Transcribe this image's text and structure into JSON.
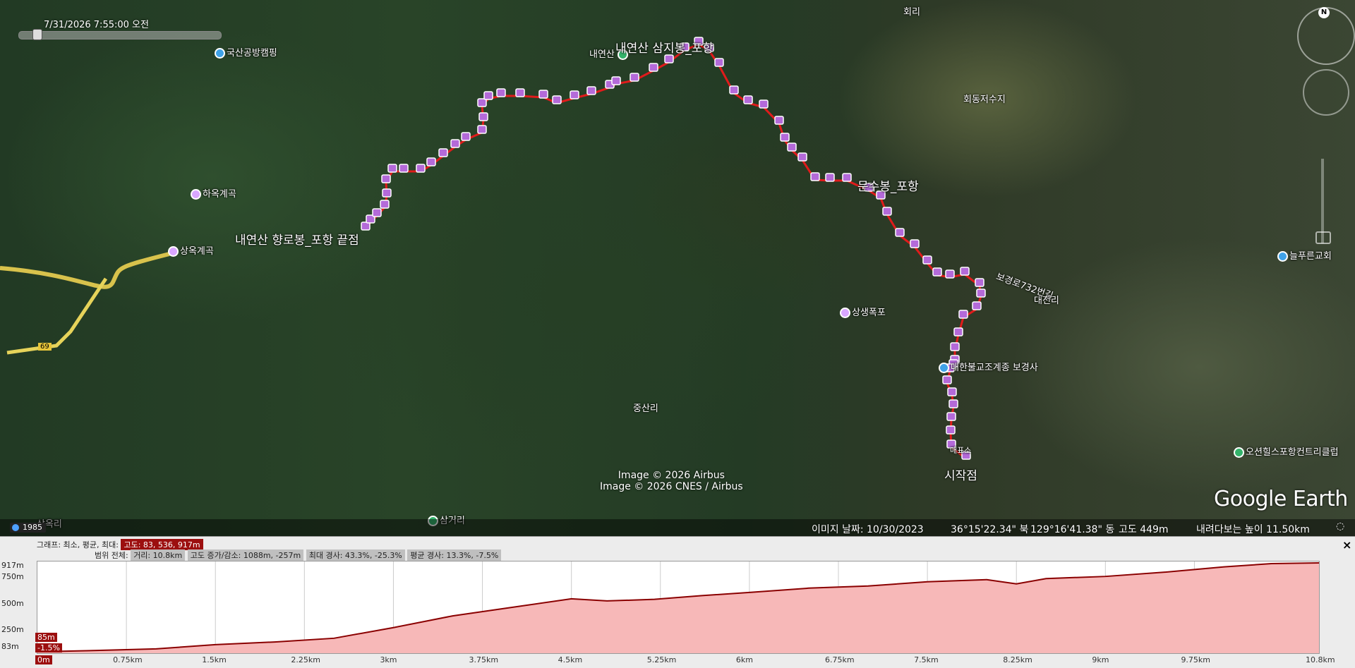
{
  "tour": {
    "timestamp": "7/31/2026   7:55:00 오전"
  },
  "map_labels": {
    "hoeri": "회리",
    "naeyeonsan": "내연산",
    "samjibong": "내연산 삼지봉_포항",
    "gugsan": "국산공방캠핑",
    "haogyegok": "하옥계곡",
    "sangok": "상옥계곡",
    "hyangrobong": "내연산 향로봉_포항 끝점",
    "munsubong": "문수봉_포항",
    "hoedong": "회동저수지",
    "daejeonri": "대전리",
    "bogyeongro": "보경로732번길",
    "sangsaeng": "상생폭포",
    "bogyeongsa": "대한불교조계종 보경사",
    "jungsanri": "중산리",
    "samgeori": "삼거리",
    "sangokri": "상옥리",
    "start": "시작점",
    "start_small": "매표소",
    "golf": "오션힐스포항컨트리클럽",
    "church": "늘푸른교회",
    "road_number": "69"
  },
  "credits": [
    "Image © 2026 Airbus",
    "Image © 2026 CNES / Airbus"
  ],
  "branding": "Google Earth",
  "year_badge": "1985",
  "status": {
    "imagery_date": "이미지 날짜: 10/30/2023",
    "lat": "36°15'22.34\" 북",
    "lon": "129°16'41.38\" 동",
    "elev": "고도   449m",
    "eye_alt": "내려다보는 높이   11.50km"
  },
  "profile": {
    "close": "×",
    "graph_label": "그래프: 최소, 평균, 최대:",
    "graph_values": "고도: 83, 536, 917m",
    "range_label": "범위 전체:",
    "range_chip1": "거리: 10.8km",
    "range_chip2": "고도 증가/감소: 1088m, -257m",
    "range_chip3": "최대 경사: 43.3%, -25.3%",
    "range_chip4": "평균 경사: 13.3%, -7.5%",
    "cursor_elev": "85m",
    "cursor_grade": "-1.5%",
    "cursor_dist": "0m",
    "y_ticks": [
      "917m",
      "750m",
      "500m",
      "250m",
      "83m"
    ],
    "x_ticks": [
      "0.75km",
      "1.5km",
      "2.25km",
      "3km",
      "3.75km",
      "4.5km",
      "5.25km",
      "6km",
      "6.75km",
      "7.5km",
      "8.25km",
      "9km",
      "9.75km",
      "10.8km"
    ]
  },
  "colors": {
    "route": "#e01b1b",
    "marker": "#b46ad9",
    "profile_fill": "#f7b8b8",
    "profile_line": "#8a0000"
  },
  "chart_data": {
    "type": "area",
    "xlabel": "",
    "ylabel": "",
    "ylim": [
      83,
      917
    ],
    "xlim": [
      0,
      10.8
    ],
    "x": [
      0,
      0.5,
      1.0,
      1.5,
      2.0,
      2.5,
      3.0,
      3.5,
      4.0,
      4.5,
      4.8,
      5.2,
      5.6,
      6.0,
      6.5,
      7.0,
      7.5,
      8.0,
      8.25,
      8.5,
      9.0,
      9.5,
      10.0,
      10.4,
      10.8
    ],
    "y": [
      83,
      95,
      110,
      150,
      175,
      210,
      310,
      420,
      500,
      580,
      560,
      575,
      610,
      640,
      680,
      700,
      740,
      760,
      720,
      770,
      790,
      830,
      880,
      910,
      917
    ]
  }
}
